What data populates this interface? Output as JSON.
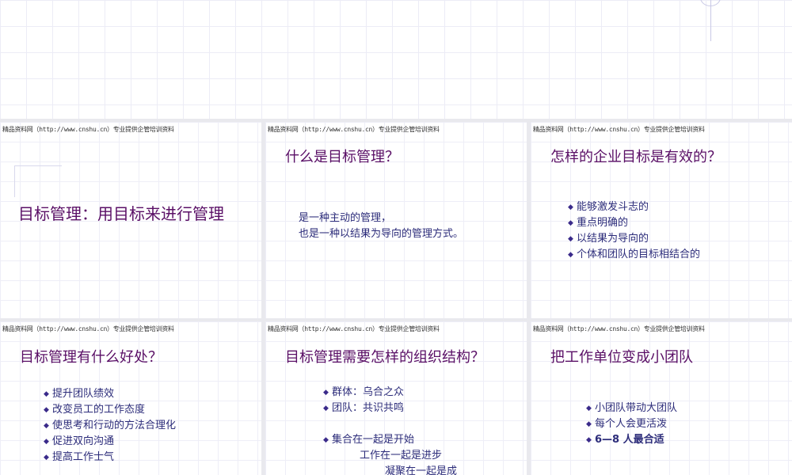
{
  "watermark": "精品资料网（http://www.cnshu.cn）专业提供企管培训资料",
  "slides": [
    {
      "title": "目标管理：用目标来进行管理"
    },
    {
      "title": "什么是目标管理？",
      "body": [
        "是一种主动的管理，",
        "也是一种以结果为导向的管理方式。"
      ]
    },
    {
      "title": "怎样的企业目标是有效的？",
      "bullets": [
        "能够激发斗志的",
        "重点明确的",
        "以结果为导向的",
        "个体和团队的目标相结合的"
      ]
    },
    {
      "title": "目标管理有什么好处？",
      "bullets": [
        "提升团队绩效",
        "改变员工的工作态度",
        "使思考和行动的方法合理化",
        "促进双向沟通",
        "提高工作士气"
      ]
    },
    {
      "title": "目标管理需要怎样的组织结构？",
      "bullets": [
        "群体：乌合之众",
        "团队：共识共鸣"
      ],
      "bullets2": [
        "集合在一起是开始"
      ],
      "lines": [
        "工作在一起是进步",
        "凝聚在一起是成"
      ]
    },
    {
      "title": "把工作单位变成小团队",
      "bullets": [
        "小团队带动大团队",
        "每个人会更活泼",
        "6—8 人最合适"
      ]
    }
  ],
  "icons": {
    "bullet": "diamond-bullet-icon"
  },
  "colors": {
    "title": "#5a0f66",
    "body": "#2c2c7a",
    "bullet": "#3a2a8a"
  }
}
